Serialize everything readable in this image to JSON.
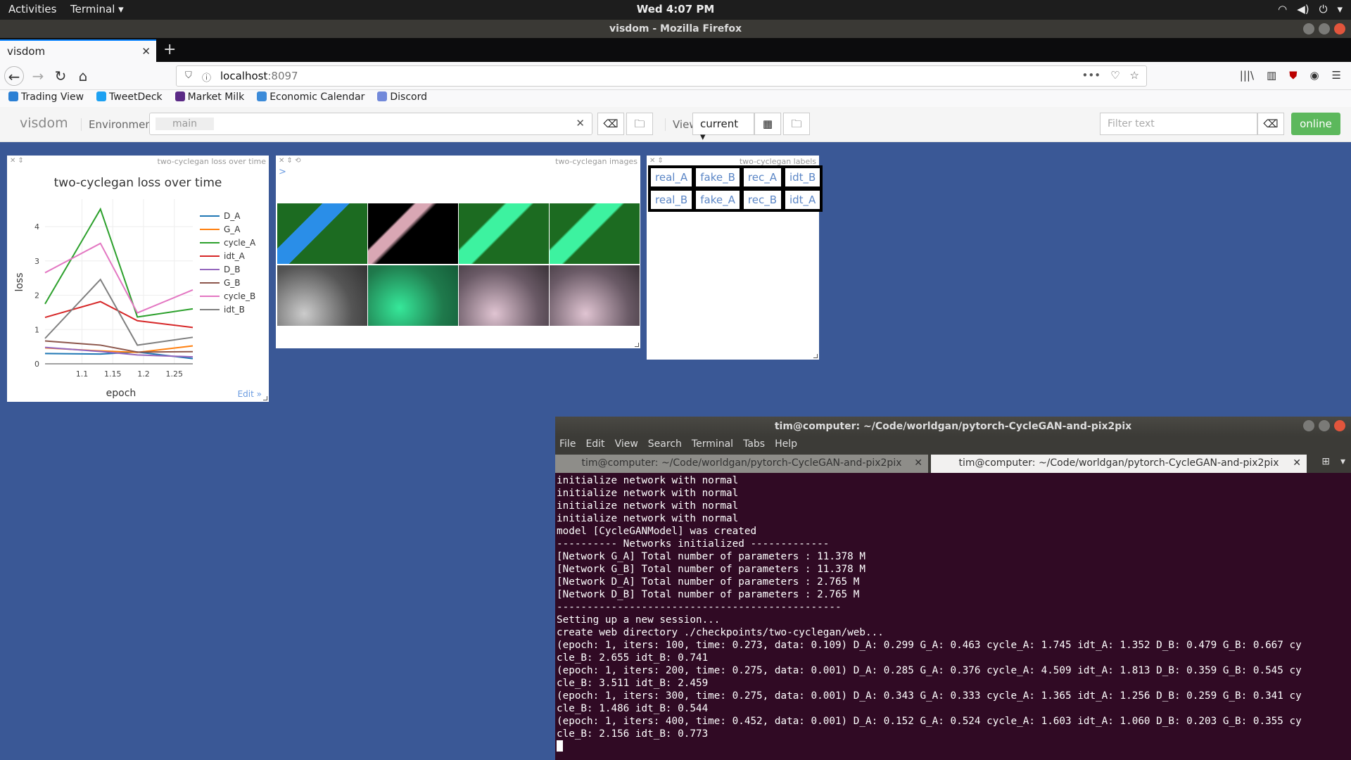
{
  "topbar": {
    "activities": "Activities",
    "app": "Terminal ▾",
    "clock": "Wed  4:07 PM"
  },
  "window": {
    "title": "visdom - Mozilla Firefox"
  },
  "browser": {
    "tab_label": "visdom",
    "url_host": "localhost",
    "url_port": ":8097",
    "bookmarks": [
      "Trading View",
      "TweetDeck",
      "Market Milk",
      "Economic Calendar",
      "Discord"
    ]
  },
  "visdom": {
    "logo": "visdom",
    "env_label": "Environment",
    "env_value": "main",
    "view_label": "View",
    "view_value": "current ▾",
    "filter_placeholder": "Filter text",
    "status": "online"
  },
  "pane_loss": {
    "title": "two-cyclegan loss over time",
    "edit": "Edit »"
  },
  "pane_images": {
    "title": "two-cyclegan images",
    "prompt": ">"
  },
  "pane_labels": {
    "title": "two-cyclegan labels",
    "rows": [
      [
        "real_A",
        "fake_B",
        "rec_A",
        "idt_B"
      ],
      [
        "real_B",
        "fake_A",
        "rec_B",
        "idt_A"
      ]
    ]
  },
  "chart_data": {
    "type": "line",
    "title": "two-cyclegan loss over time",
    "xlabel": "epoch",
    "ylabel": "loss",
    "x": [
      1.04,
      1.13,
      1.19,
      1.28
    ],
    "xticks": [
      "1.1",
      "1.15",
      "1.2",
      "1.25"
    ],
    "yticks": [
      "0",
      "1",
      "2",
      "3",
      "4"
    ],
    "xlim": [
      1.04,
      1.28
    ],
    "ylim": [
      0,
      4.8
    ],
    "legend": "right",
    "series": [
      {
        "name": "D_A",
        "color": "#1f77b4",
        "values": [
          0.299,
          0.285,
          0.343,
          0.152
        ]
      },
      {
        "name": "G_A",
        "color": "#ff7f0e",
        "values": [
          0.463,
          0.376,
          0.333,
          0.524
        ]
      },
      {
        "name": "cycle_A",
        "color": "#2ca02c",
        "values": [
          1.745,
          4.509,
          1.365,
          1.603
        ]
      },
      {
        "name": "idt_A",
        "color": "#d62728",
        "values": [
          1.352,
          1.813,
          1.256,
          1.06
        ]
      },
      {
        "name": "D_B",
        "color": "#9467bd",
        "values": [
          0.479,
          0.359,
          0.259,
          0.203
        ]
      },
      {
        "name": "G_B",
        "color": "#8c564b",
        "values": [
          0.667,
          0.545,
          0.341,
          0.355
        ]
      },
      {
        "name": "cycle_B",
        "color": "#e377c2",
        "values": [
          2.655,
          3.511,
          1.486,
          2.156
        ]
      },
      {
        "name": "idt_B",
        "color": "#7f7f7f",
        "values": [
          0.741,
          2.459,
          0.544,
          0.773
        ]
      }
    ]
  },
  "terminal": {
    "title": "tim@computer: ~/Code/worldgan/pytorch-CycleGAN-and-pix2pix",
    "menu": [
      "File",
      "Edit",
      "View",
      "Search",
      "Terminal",
      "Tabs",
      "Help"
    ],
    "tabs": [
      "tim@computer: ~/Code/worldgan/pytorch-CycleGAN-and-pix2pix",
      "tim@computer: ~/Code/worldgan/pytorch-CycleGAN-and-pix2pix"
    ],
    "lines": [
      "initialize network with normal",
      "initialize network with normal",
      "initialize network with normal",
      "initialize network with normal",
      "model [CycleGANModel] was created",
      "---------- Networks initialized -------------",
      "[Network G_A] Total number of parameters : 11.378 M",
      "[Network G_B] Total number of parameters : 11.378 M",
      "[Network D_A] Total number of parameters : 2.765 M",
      "[Network D_B] Total number of parameters : 2.765 M",
      "-----------------------------------------------",
      "Setting up a new session...",
      "create web directory ./checkpoints/two-cyclegan/web...",
      "(epoch: 1, iters: 100, time: 0.273, data: 0.109) D_A: 0.299 G_A: 0.463 cycle_A: 1.745 idt_A: 1.352 D_B: 0.479 G_B: 0.667 cy",
      "cle_B: 2.655 idt_B: 0.741",
      "(epoch: 1, iters: 200, time: 0.275, data: 0.001) D_A: 0.285 G_A: 0.376 cycle_A: 4.509 idt_A: 1.813 D_B: 0.359 G_B: 0.545 cy",
      "cle_B: 3.511 idt_B: 2.459",
      "(epoch: 1, iters: 300, time: 0.275, data: 0.001) D_A: 0.343 G_A: 0.333 cycle_A: 1.365 idt_A: 1.256 D_B: 0.259 G_B: 0.341 cy",
      "cle_B: 1.486 idt_B: 0.544",
      "(epoch: 1, iters: 400, time: 0.452, data: 0.001) D_A: 0.152 G_A: 0.524 cycle_A: 1.603 idt_A: 1.060 D_B: 0.203 G_B: 0.355 cy",
      "cle_B: 2.156 idt_B: 0.773"
    ]
  }
}
